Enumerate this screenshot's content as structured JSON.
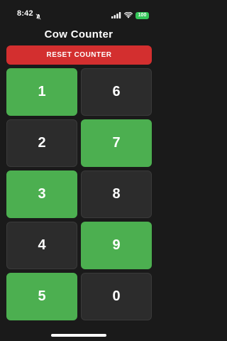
{
  "status_bar": {
    "time": "8:42",
    "battery": "100"
  },
  "app": {
    "title": "Cow Counter",
    "reset_label": "RESET COUNTER"
  },
  "buttons": [
    {
      "label": "1",
      "active": true
    },
    {
      "label": "6",
      "active": false
    },
    {
      "label": "2",
      "active": false
    },
    {
      "label": "7",
      "active": true
    },
    {
      "label": "3",
      "active": true
    },
    {
      "label": "8",
      "active": false
    },
    {
      "label": "4",
      "active": false
    },
    {
      "label": "9",
      "active": true
    },
    {
      "label": "5",
      "active": true
    },
    {
      "label": "0",
      "active": false
    }
  ],
  "colors": {
    "background": "#1a1a1a",
    "reset": "#d32f2f",
    "active": "#4caf50",
    "inactive": "#2c2c2c"
  }
}
